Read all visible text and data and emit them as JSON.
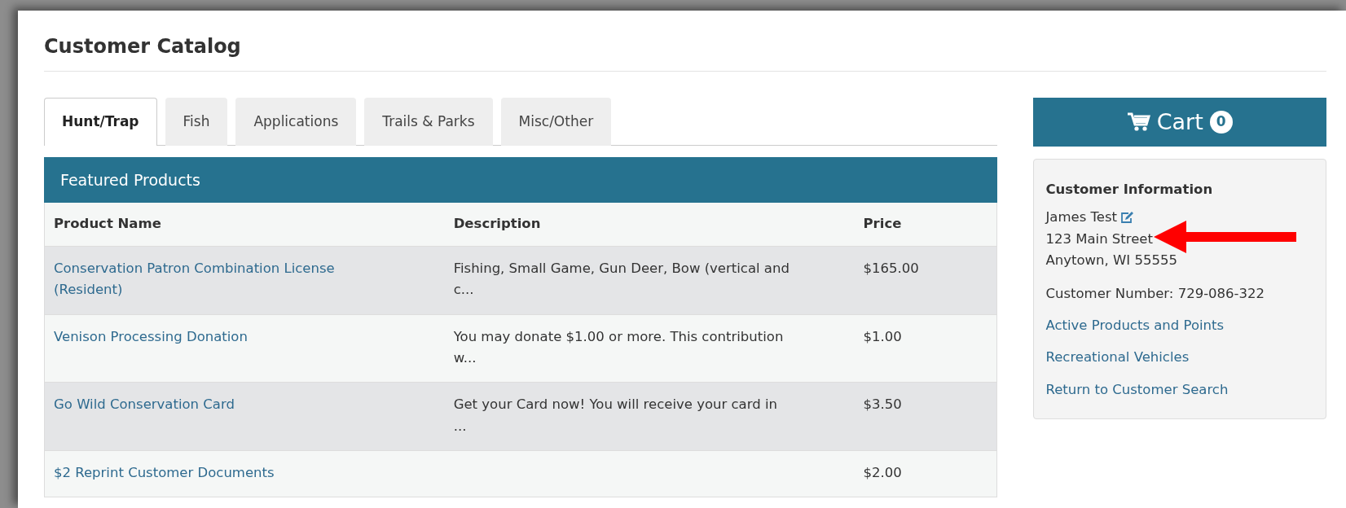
{
  "page_title": "Customer Catalog",
  "tabs": [
    {
      "label": "Hunt/Trap",
      "selected": true
    },
    {
      "label": "Fish",
      "selected": false
    },
    {
      "label": "Applications",
      "selected": false
    },
    {
      "label": "Trails & Parks",
      "selected": false
    },
    {
      "label": "Misc/Other",
      "selected": false
    }
  ],
  "featured": {
    "title": "Featured Products",
    "columns": [
      "Product Name",
      "Description",
      "Price"
    ],
    "rows": [
      {
        "name": "Conservation Patron Combination License (Resident)",
        "description": "Fishing, Small Game, Gun Deer, Bow (vertical and c...",
        "price": "$165.00"
      },
      {
        "name": "Venison Processing Donation",
        "description": "You may donate $1.00 or more. This contribution w...",
        "price": "$1.00"
      },
      {
        "name": "Go Wild Conservation Card",
        "description": "Get your Card now! You will receive your card in ...",
        "price": "$3.50"
      },
      {
        "name": "$2 Reprint Customer Documents",
        "description": "",
        "price": "$2.00"
      }
    ]
  },
  "cart": {
    "label": "Cart",
    "count": "0"
  },
  "customer": {
    "heading": "Customer Information",
    "name": "James Test",
    "address_lines": [
      "123 Main Street",
      "Anytown, WI 55555"
    ],
    "customer_number": "Customer Number: 729-086-322",
    "links": [
      "Active Products and Points",
      "Recreational Vehicles",
      "Return to Customer Search"
    ]
  }
}
